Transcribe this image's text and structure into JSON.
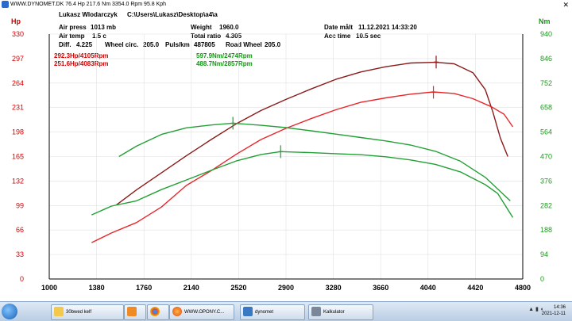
{
  "window": {
    "title": "WWW.DYNOMET.DK  76.4 Hp 217.6 Nm 3354.0 Rpm 95.8 Kph",
    "close_glyph": "✕",
    "icon": "dynomet-app-icon"
  },
  "header": {
    "name_label": "Lukasz Wlodarczyk",
    "path_label": "C:\\Users\\Lukasz\\Desktop\\a4\\a",
    "air_press_label": "Air press",
    "air_press_value": "1013 mb",
    "weight_label": "Weight",
    "weight_value": "1960.0",
    "date_label": "Date målt",
    "date_value": "11.12.2021 14:33:20",
    "air_temp_label": "Air temp",
    "air_temp_value": "1.5 c",
    "total_ratio_label": "Total ratio",
    "total_ratio_value": "4.305",
    "acc_time_label": "Acc time",
    "acc_time_value": "10.5 sec",
    "diff_label": "Diff.",
    "diff_value": "4.225",
    "wheel_circ_label": "Wheel circ.",
    "wheel_circ_value": "205.0",
    "puls_label": "Puls/km",
    "puls_value": "487805",
    "road_wheel_label": "Road Wheel",
    "road_wheel_value": "205.0",
    "peak_hp_1": "292.3Hp/4105Rpm",
    "peak_hp_2": "251.6Hp/4083Rpm",
    "peak_nm_1": "597.9Nm/2474Rpm",
    "peak_nm_2": "488.7Nm/2857Rpm"
  },
  "chart_data": {
    "type": "line",
    "xlabel": "",
    "ylabel_left": "Hp",
    "ylabel_right": "Nm",
    "xlim": [
      1000,
      4800
    ],
    "ylim_left": [
      0,
      330
    ],
    "ylim_right": [
      0,
      940
    ],
    "x_ticks": [
      "1000",
      "1380",
      "1760",
      "2140",
      "2520",
      "2900",
      "3280",
      "3660",
      "4040",
      "4420",
      "4800"
    ],
    "y_ticks_left": [
      "0",
      "33",
      "66",
      "99",
      "132",
      "165",
      "198",
      "231",
      "264",
      "297",
      "330"
    ],
    "y_ticks_right": [
      "0",
      "94",
      "188",
      "282",
      "376",
      "470",
      "564",
      "658",
      "752",
      "846",
      "940"
    ],
    "grid": true,
    "series": [
      {
        "name": "292.3Hp/4105Rpm",
        "axis": "left",
        "color": "#8b1a1a",
        "x": [
          1540,
          1700,
          1900,
          2100,
          2300,
          2500,
          2700,
          2900,
          3100,
          3300,
          3500,
          3700,
          3900,
          4100,
          4250,
          4400,
          4500,
          4560,
          4620,
          4680
        ],
        "y": [
          100,
          120,
          143,
          166,
          188,
          209,
          227,
          242,
          256,
          269,
          279,
          286,
          291,
          292,
          290,
          278,
          255,
          225,
          190,
          165
        ]
      },
      {
        "name": "251.6Hp/4083Rpm",
        "axis": "left",
        "color": "#e8262a",
        "x": [
          1340,
          1500,
          1700,
          1900,
          2100,
          2300,
          2500,
          2700,
          2900,
          3100,
          3300,
          3500,
          3700,
          3900,
          4083,
          4250,
          4400,
          4550,
          4650,
          4720
        ],
        "y": [
          49,
          62,
          76,
          97,
          126,
          146,
          168,
          188,
          203,
          216,
          228,
          238,
          244,
          249,
          252,
          250,
          243,
          232,
          222,
          205
        ]
      },
      {
        "name": "597.9Nm/2474Rpm",
        "axis": "right",
        "color": "#22a035",
        "x": [
          1560,
          1700,
          1900,
          2100,
          2300,
          2474,
          2700,
          2900,
          3100,
          3300,
          3500,
          3700,
          3900,
          4100,
          4300,
          4500,
          4700
        ],
        "y": [
          470,
          510,
          555,
          580,
          591,
          598,
          590,
          581,
          569,
          556,
          543,
          530,
          514,
          490,
          452,
          390,
          300
        ]
      },
      {
        "name": "488.7Nm/2857Rpm",
        "axis": "right",
        "color": "#22a035",
        "x": [
          1340,
          1500,
          1700,
          1900,
          2100,
          2300,
          2500,
          2700,
          2857,
          3100,
          3300,
          3500,
          3700,
          3900,
          4100,
          4300,
          4500,
          4600,
          4720
        ],
        "y": [
          246,
          280,
          300,
          343,
          380,
          417,
          453,
          478,
          489,
          485,
          481,
          477,
          469,
          457,
          440,
          411,
          362,
          328,
          236
        ]
      }
    ],
    "peak_markers": [
      {
        "series": 0,
        "x": 4105,
        "y": 292.3
      },
      {
        "series": 1,
        "x": 4083,
        "y": 251.6
      },
      {
        "series": 2,
        "x": 2474,
        "y": 597.9
      },
      {
        "series": 3,
        "x": 2857,
        "y": 488.7
      }
    ],
    "colors": {
      "left_axis": "#d40000",
      "right_axis": "#1a9a1a",
      "x_axis": "#000000",
      "grid": "#e0e0e0"
    }
  },
  "taskbar": {
    "start_icon": "windows-start-orb",
    "items": [
      {
        "label": "30bwed kelf",
        "icon": "folder-icon"
      },
      {
        "label": "",
        "icon": "media-player-icon"
      },
      {
        "label": "",
        "icon": "chrome-icon"
      },
      {
        "label": "WWW.OPONY.C...",
        "icon": "firefox-icon"
      },
      {
        "label": "dynomet",
        "icon": "dynomet-icon"
      },
      {
        "label": "Kalkulator",
        "icon": "calculator-icon"
      }
    ],
    "time": "14:36",
    "date": "2021-12-11"
  }
}
